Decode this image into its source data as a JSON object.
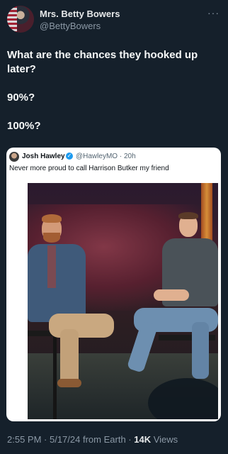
{
  "author": {
    "display_name": "Mrs. Betty Bowers",
    "handle": "@BettyBowers"
  },
  "more_menu": "···",
  "tweet": {
    "lines": [
      "What are the chances they hooked up later?",
      "90%?",
      "100%?"
    ]
  },
  "quoted_tweet": {
    "display_name": "Josh Hawley",
    "verified_icon": "✓",
    "handle": "@HawleyMO",
    "separator": "·",
    "time": "20h",
    "text": "Never more proud to call Harrison Butker my friend"
  },
  "footer": {
    "time": "2:55 PM",
    "date": "5/17/24",
    "source": "from Earth",
    "views_count": "14K",
    "views_label": "Views"
  },
  "colors": {
    "background": "#15202b",
    "text": "#e7e9ea",
    "secondary_text": "#8b98a5",
    "verified": "#1d9bf0"
  }
}
